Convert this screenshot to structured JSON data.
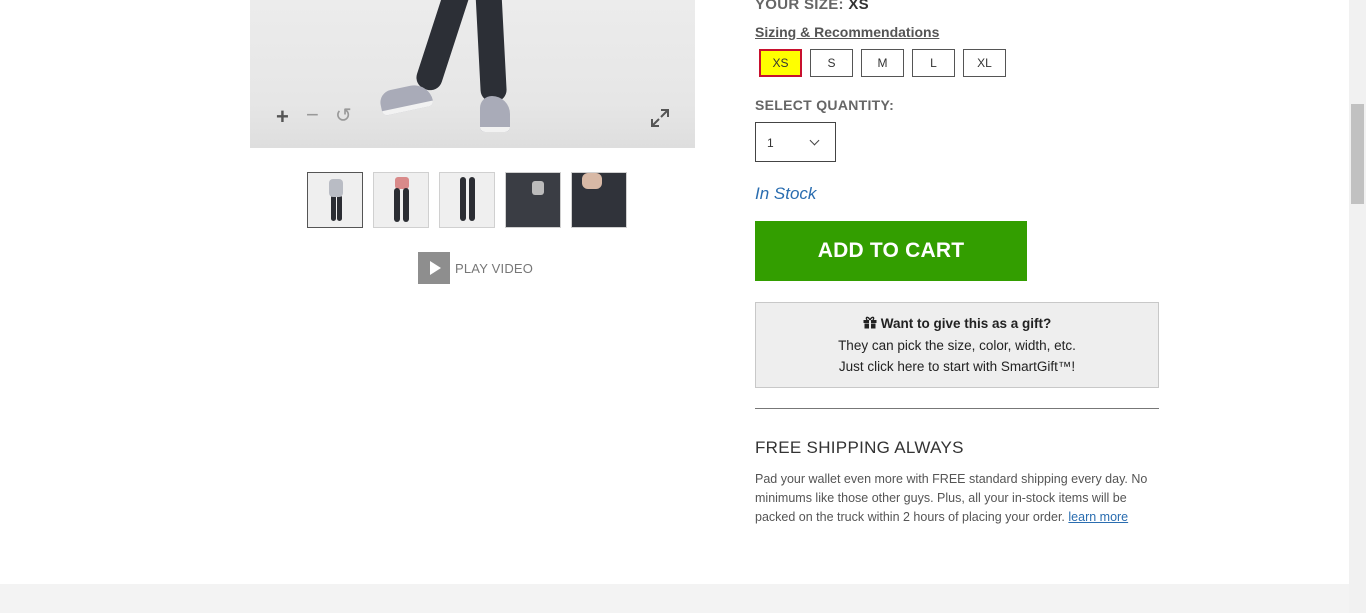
{
  "product_media": {
    "zoom_in_icon": "+",
    "zoom_out_icon": "−",
    "reset_icon": "↺",
    "thumbnails": [
      "thumb-1",
      "thumb-2",
      "thumb-3",
      "thumb-4",
      "thumb-5"
    ],
    "play_video_label": "PLAY VIDEO"
  },
  "size": {
    "label": "YOUR SIZE:",
    "value": "XS",
    "sizing_link": "Sizing & Recommendations",
    "options": [
      "XS",
      "S",
      "M",
      "L",
      "XL"
    ],
    "selected": "XS"
  },
  "quantity": {
    "label": "SELECT QUANTITY:",
    "value": "1"
  },
  "stock_status": "In Stock",
  "add_to_cart_label": "ADD TO CART",
  "gift": {
    "title": "Want to give this as a gift?",
    "line1": "They can pick the size, color, width, etc.",
    "line2": "Just click here to start with SmartGift™!"
  },
  "shipping": {
    "title": "FREE SHIPPING ALWAYS",
    "body": "Pad your wallet even more with FREE standard shipping every day. No minimums like those other guys. Plus, all your in-stock items will be packed on the truck within 2 hours of placing your order.",
    "link": "learn more"
  },
  "colors": {
    "add_to_cart": "#339e00",
    "selected_size_bg": "#ffff00",
    "selected_size_border": "#c8102e",
    "link": "#2a6db0"
  }
}
